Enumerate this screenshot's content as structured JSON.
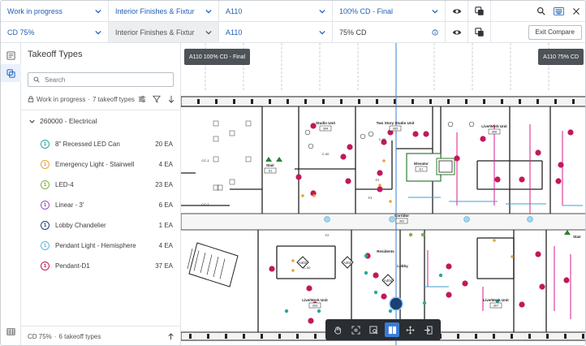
{
  "row1": {
    "status": "Work in progress",
    "discipline": "Interior Finishes & Fixtur",
    "sheet": "A110",
    "version": "100% CD - Final"
  },
  "row2": {
    "status": "CD 75%",
    "discipline": "Interior Finishes & Fixtur",
    "sheet": "A110",
    "version": "75% CD",
    "exit_label": "Exit Compare"
  },
  "panel": {
    "title": "Takeoff Types",
    "search_placeholder": "Search",
    "wip_label": "Work in progress",
    "wip_count": "7 takeoff types",
    "group_label": "260000 - Electrical",
    "footer_label": "CD 75%",
    "footer_count": "6 takeoff types",
    "items": [
      {
        "num": "1",
        "label": "8\" Recessed LED Can",
        "qty": "20 EA",
        "color": "#2aa79b"
      },
      {
        "num": "1",
        "label": "Emergency Light - Stairwell",
        "qty": "4 EA",
        "color": "#e8a33a"
      },
      {
        "num": "1",
        "label": "LED-4",
        "qty": "23 EA",
        "color": "#7cb342"
      },
      {
        "num": "1",
        "label": "Linear - 3'",
        "qty": "6 EA",
        "color": "#9c4dc2"
      },
      {
        "num": "1",
        "label": "Lobby Chandelier",
        "qty": "1 EA",
        "color": "#1d3f73"
      },
      {
        "num": "1",
        "label": "Pendant Light - Hemisphere",
        "qty": "4 EA",
        "color": "#5cb8e4"
      },
      {
        "num": "1",
        "label": "Pendant-D1",
        "qty": "37 EA",
        "color": "#c2185b"
      }
    ]
  },
  "canvas": {
    "left_tag": "A110 100% CD - Final",
    "right_tag": "A110 75% CD",
    "rooms": [
      {
        "name": "Stair",
        "num": "S1"
      },
      {
        "name": "Studio Unit",
        "num": "304"
      },
      {
        "name": "Two Story Studio Unit",
        "num": "305"
      },
      {
        "name": "Live/Work Unit",
        "num": "306"
      },
      {
        "name": "Elevator",
        "num": "E1"
      },
      {
        "name": "Corridor",
        "num": "302"
      },
      {
        "name": "Residents",
        "num": ""
      },
      {
        "name": "Lobby",
        "num": ""
      },
      {
        "name": "Live/Work Unit",
        "num": "303"
      },
      {
        "name": "Live/Work Unit",
        "num": "307"
      },
      {
        "name": "Stair",
        "num": ""
      }
    ],
    "tags": [
      "F2",
      "F2",
      "F3",
      "A402",
      "A402",
      "A404",
      "C-00",
      "C-00",
      "C-00",
      "CC-1",
      "CC-1"
    ]
  }
}
